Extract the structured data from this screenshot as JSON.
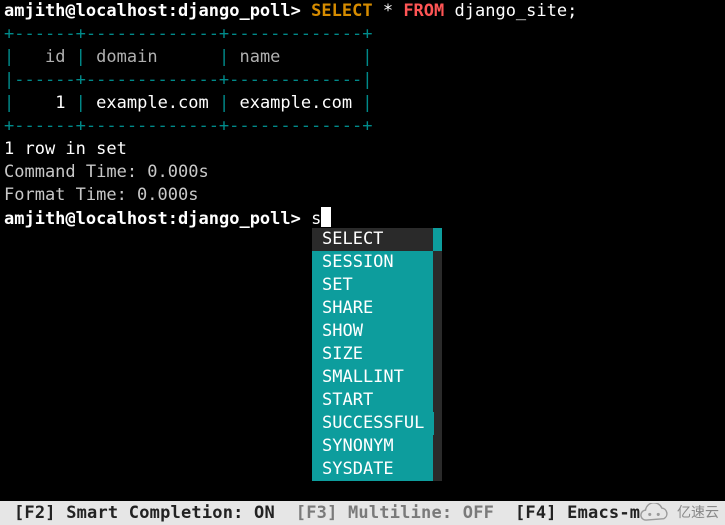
{
  "prompt": {
    "user": "amjith",
    "host": "localhost",
    "db": "django_poll",
    "suffix": ">"
  },
  "query": {
    "kw_select": "SELECT",
    "star": "*",
    "kw_from": "FROM",
    "table": "django_site",
    "terminator": ";"
  },
  "table": {
    "border_top": "+------+-------------+-------------+",
    "border_mid": "|------+-------------+-------------|",
    "border_bottom": "+------+-------------+-------------+",
    "header_row": {
      "c0": "id",
      "c1": "domain",
      "c2": "name"
    },
    "rows": [
      {
        "c0": "1",
        "c1": "example.com",
        "c2": "example.com"
      }
    ]
  },
  "status": {
    "row_count": "1 row in set",
    "command_time": "Command Time: 0.000s",
    "format_time": "Format Time: 0.000s"
  },
  "input": {
    "typed": "s"
  },
  "autocomplete": {
    "items": [
      "SELECT",
      "SESSION",
      "SET",
      "SHARE",
      "SHOW",
      "SIZE",
      "SMALLINT",
      "START",
      "SUCCESSFUL",
      "SYNONYM",
      "SYSDATE"
    ],
    "selected_index": 0
  },
  "toolbar": {
    "f2_key": "[F2]",
    "f2_label": "Smart Completion:",
    "f2_state": "ON",
    "f3_key": "[F3]",
    "f3_label": "Multiline:",
    "f3_state": "OFF",
    "f4_key": "[F4]",
    "f4_label": "Emacs-m"
  },
  "watermark": {
    "text": "亿速云"
  }
}
